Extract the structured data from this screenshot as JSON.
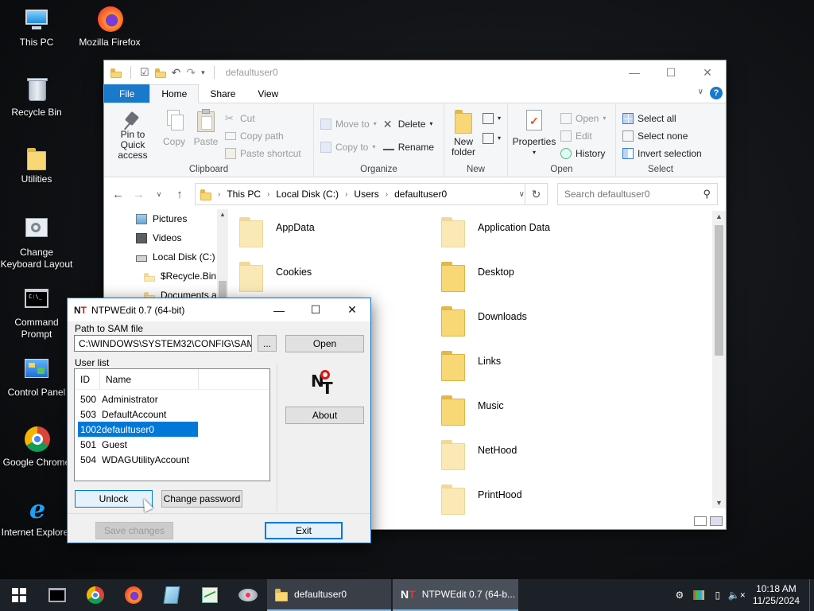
{
  "desktop": {
    "icons": [
      {
        "label": "This PC",
        "icon": "this-pc-icon"
      },
      {
        "label": "Mozilla Firefox",
        "icon": "firefox-icon"
      },
      {
        "label": "Recycle Bin",
        "icon": "recycle-bin-icon"
      },
      {
        "label": "Utilities",
        "icon": "folder-icon"
      },
      {
        "label": "Change Keyboard Layout",
        "label_line1": "Change",
        "label_line2": "Keyboard Layout",
        "icon": "keyboard-settings-icon"
      },
      {
        "label": "Command Prompt",
        "label_line1": "Command",
        "label_line2": "Prompt",
        "icon": "cmd-icon"
      },
      {
        "label": "Control Panel",
        "icon": "control-panel-icon"
      },
      {
        "label": "Google Chrome",
        "icon": "chrome-icon"
      },
      {
        "label": "Internet Explorer",
        "icon": "ie-icon"
      }
    ]
  },
  "explorer": {
    "title": "defaultuser0",
    "tabs": {
      "file": "File",
      "home": "Home",
      "share": "Share",
      "view": "View"
    },
    "clipboard": {
      "group": "Clipboard",
      "pin_line1": "Pin to Quick",
      "pin_line2": "access",
      "copy": "Copy",
      "paste": "Paste",
      "cut": "Cut",
      "copy_path": "Copy path",
      "paste_shortcut": "Paste shortcut"
    },
    "organize": {
      "group": "Organize",
      "move_to": "Move to",
      "copy_to": "Copy to",
      "delete": "Delete",
      "rename": "Rename"
    },
    "new": {
      "group": "New",
      "new_folder_line1": "New",
      "new_folder_line2": "folder"
    },
    "open": {
      "group": "Open",
      "properties": "Properties",
      "open": "Open",
      "edit": "Edit",
      "history": "History"
    },
    "select": {
      "group": "Select",
      "select_all": "Select all",
      "select_none": "Select none",
      "invert": "Invert selection"
    },
    "address": {
      "crumbs": [
        "This PC",
        "Local Disk (C:)",
        "Users",
        "defaultuser0"
      ]
    },
    "search_placeholder": "Search defaultuser0",
    "nav_items": [
      "Pictures",
      "Videos",
      "Local Disk (C:)",
      "$Recycle.Bin",
      "Documents a"
    ],
    "folders_left": [
      "AppData",
      "Cookies"
    ],
    "folders_right": [
      "Application Data",
      "Desktop",
      "Downloads",
      "Links",
      "Music",
      "NetHood",
      "PrintHood"
    ]
  },
  "ntpwedit": {
    "title": "NTPWEdit 0.7 (64-bit)",
    "sam_label": "Path to SAM file",
    "sam_path": "C:\\WINDOWS\\SYSTEM32\\CONFIG\\SAM",
    "browse": "...",
    "open": "Open",
    "user_list_label": "User list",
    "columns": {
      "id": "ID",
      "name": "Name"
    },
    "users": [
      {
        "id": "500",
        "name": "Administrator"
      },
      {
        "id": "503",
        "name": "DefaultAccount"
      },
      {
        "id": "1002",
        "name": "defaultuser0"
      },
      {
        "id": "501",
        "name": "Guest"
      },
      {
        "id": "504",
        "name": "WDAGUtilityAccount"
      }
    ],
    "selected_user_id": "1002",
    "about": "About",
    "unlock": "Unlock",
    "change_password": "Change password",
    "save_changes": "Save changes",
    "exit": "Exit"
  },
  "taskbar": {
    "tasks": [
      {
        "label": "defaultuser0",
        "icon": "folder-icon"
      },
      {
        "label": "NTPWEdit 0.7 (64-b...",
        "icon": "ntpwedit-icon"
      }
    ],
    "time": "10:18 AM",
    "date": "11/25/2024"
  }
}
